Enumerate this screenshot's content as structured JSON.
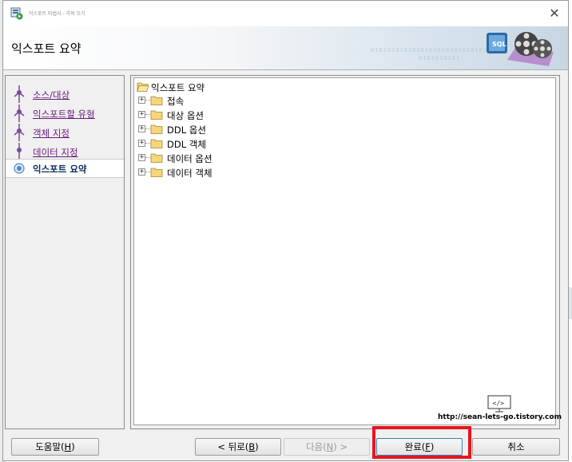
{
  "window": {
    "title": "익스포트 마법사 - 가져 오기",
    "app_icon": "wizard-app-icon",
    "close_glyph": "✕"
  },
  "header": {
    "title": "익스포트 요약",
    "binary_line1": "0101010101010101010101010101",
    "binary_line2": "0101010101",
    "graphic": "sql-film-reel-graphic",
    "graphic_text": "SQL"
  },
  "steps": [
    {
      "label": "소스/대상",
      "state": "completed"
    },
    {
      "label": "익스포트할 유형",
      "state": "completed"
    },
    {
      "label": "객체 지정",
      "state": "completed"
    },
    {
      "label": "데이터 지정",
      "state": "completed"
    },
    {
      "label": "익스포트 요약",
      "state": "current"
    }
  ],
  "tree": {
    "root_label": "익스포트 요약",
    "items": [
      {
        "label": "접속"
      },
      {
        "label": "대상 옵션"
      },
      {
        "label": "DDL 옵션"
      },
      {
        "label": "DDL 객체"
      },
      {
        "label": "데이터 옵션"
      },
      {
        "label": "데이터 객체"
      }
    ]
  },
  "watermark": {
    "icon": "code-monitor-icon",
    "icon_text": "</>",
    "text": "http://sean-lets-go.tistory.com"
  },
  "buttons": {
    "help": {
      "text": "도움말(",
      "mnemonic": "H",
      "tail": ")"
    },
    "back": {
      "text": "< 뒤로(",
      "mnemonic": "B",
      "tail": ")"
    },
    "next": {
      "text": "다음(",
      "mnemonic": "N",
      "tail": ") >"
    },
    "finish": {
      "text": "완료(",
      "mnemonic": "F",
      "tail": ")"
    },
    "cancel": {
      "text": "취소",
      "mnemonic": "",
      "tail": ""
    }
  },
  "colors": {
    "highlight": "#e8141e",
    "completed_step": "#6a1b7a",
    "current_step": "#0a2a5e"
  }
}
